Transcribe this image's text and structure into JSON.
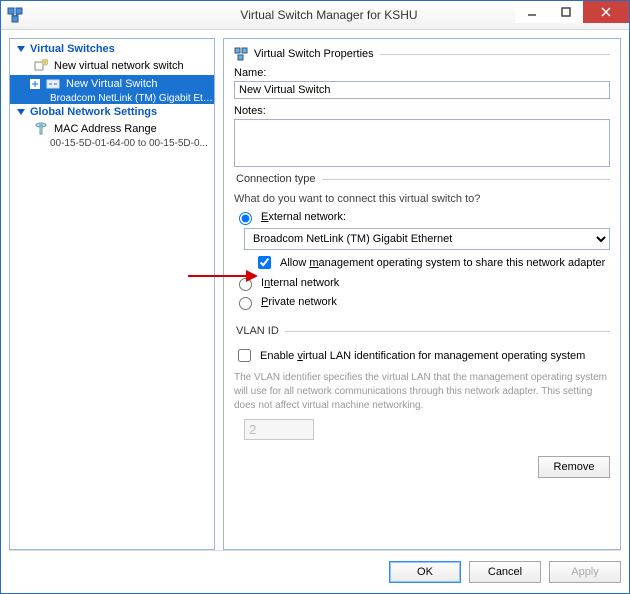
{
  "window": {
    "title": "Virtual Switch Manager for KSHU"
  },
  "tree": {
    "virtual_switches_header": "Virtual Switches",
    "new_switch_item": "New virtual network switch",
    "selected_switch": "New Virtual Switch",
    "selected_switch_sub": "Broadcom NetLink (TM) Gigabit Eth...",
    "global_header": "Global Network Settings",
    "mac_range": "MAC Address Range",
    "mac_range_sub": "00-15-5D-01-64-00 to 00-15-5D-0..."
  },
  "props": {
    "section_title": "Virtual Switch Properties",
    "name_label": "Name:",
    "name_value": "New Virtual Switch",
    "notes_label": "Notes:",
    "notes_value": ""
  },
  "conn": {
    "legend": "Connection type",
    "question": "What do you want to connect this virtual switch to?",
    "external_label": "External network:",
    "adapter_selected": "Broadcom NetLink (TM) Gigabit Ethernet",
    "allow_mgmt_label": "Allow management operating system to share this network adapter",
    "internal_label": "Internal network",
    "private_label": "Private network"
  },
  "vlan": {
    "legend": "VLAN ID",
    "enable_label": "Enable virtual LAN identification for management operating system",
    "help_text": "The VLAN identifier specifies the virtual LAN that the management operating system will use for all network communications through this network adapter. This setting does not affect virtual machine networking.",
    "value": "2"
  },
  "buttons": {
    "remove": "Remove",
    "ok": "OK",
    "cancel": "Cancel",
    "apply": "Apply"
  }
}
